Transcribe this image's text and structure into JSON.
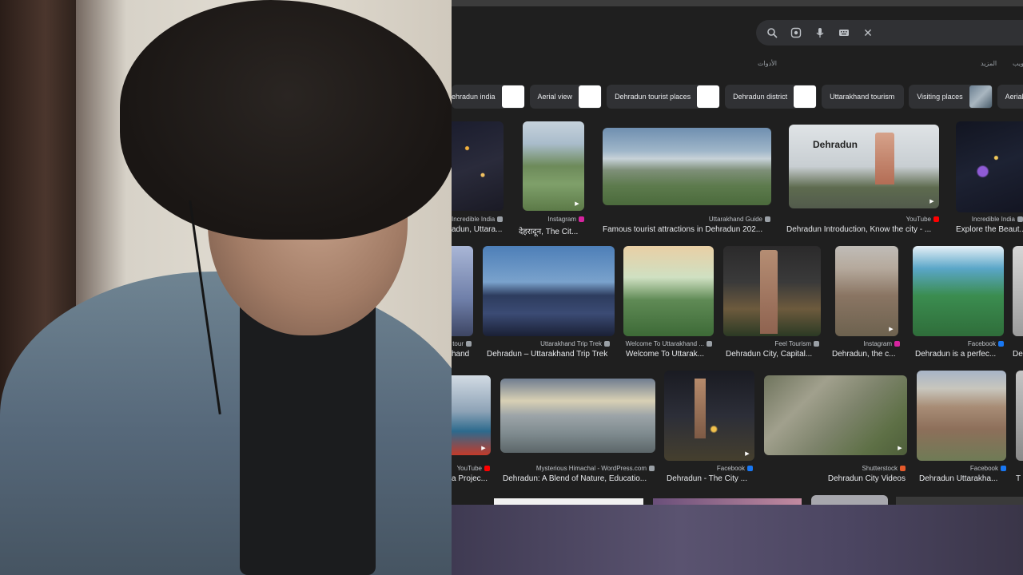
{
  "search": {
    "icons": [
      "search-icon",
      "lens-icon",
      "mic-icon",
      "keyboard-icon",
      "close-icon"
    ],
    "close_glyph": "✕"
  },
  "tools_row": {
    "tools": "الأدوات",
    "more": "المزيد",
    "other": "ويب"
  },
  "chips": [
    {
      "label": "ehradun india"
    },
    {
      "label": "Aerial view"
    },
    {
      "label": "Dehradun tourist places"
    },
    {
      "label": "Dehradun district"
    },
    {
      "label": "Uttarakhand tourism"
    },
    {
      "label": "Visiting places"
    },
    {
      "label": "Aerial"
    }
  ],
  "rows": [
    {
      "cards": [
        {
          "source": "Incredible India",
          "title": "adun, Uttara...",
          "fav_color": "#9aa0a6"
        },
        {
          "source": "Instagram",
          "title": "देहरादून, The Cit...",
          "fav_color": "#d6249f"
        },
        {
          "source": "Uttarakhand Guide",
          "title": "Famous tourist attractions in Dehradun 202...",
          "fav_color": "#9aa0a6"
        },
        {
          "source": "YouTube",
          "title": "Dehradun Introduction, Know the city - ...",
          "fav_color": "#ff0000"
        },
        {
          "source": "Incredible India",
          "title": "Explore the Beaut...",
          "fav_color": "#9aa0a6"
        }
      ]
    },
    {
      "cards": [
        {
          "source": "tour",
          "title": "hand",
          "fav_color": "#9aa0a6"
        },
        {
          "source": "Uttarakhand Trip Trek",
          "title": "Dehradun – Uttarakhand Trip Trek",
          "fav_color": "#9aa0a6"
        },
        {
          "source": "Welcome To Uttarakhand ...",
          "title": "Welcome To Uttarak...",
          "fav_color": "#9aa0a6"
        },
        {
          "source": "Feel Tourism",
          "title": "Dehradun City, Capital...",
          "fav_color": "#9aa0a6"
        },
        {
          "source": "Instagram",
          "title": "Dehradun, the c...",
          "fav_color": "#d6249f"
        },
        {
          "source": "Facebook",
          "title": "Dehradun is a perfec...",
          "fav_color": "#1877f2"
        },
        {
          "source": "",
          "title": "De",
          "fav_color": "#9aa0a6"
        }
      ]
    },
    {
      "cards": [
        {
          "source": "YouTube",
          "title": "a Projec...",
          "fav_color": "#ff0000"
        },
        {
          "source": "Mysterious Himachal - WordPress.com",
          "title": "Dehradun: A Blend of Nature, Educatio...",
          "fav_color": "#9aa0a6"
        },
        {
          "source": "Facebook",
          "title": "Dehradun - The City ...",
          "fav_color": "#1877f2"
        },
        {
          "source": "Shutterstock",
          "title": "Dehradun City Videos",
          "fav_color": "#e55a2b"
        },
        {
          "source": "Facebook",
          "title": "Dehradun Uttarakha...",
          "fav_color": "#1877f2"
        },
        {
          "source": "",
          "title": "T",
          "fav_color": "#9aa0a6"
        }
      ]
    }
  ],
  "image_texts": {
    "dehradun_intro": "Dehradun"
  }
}
